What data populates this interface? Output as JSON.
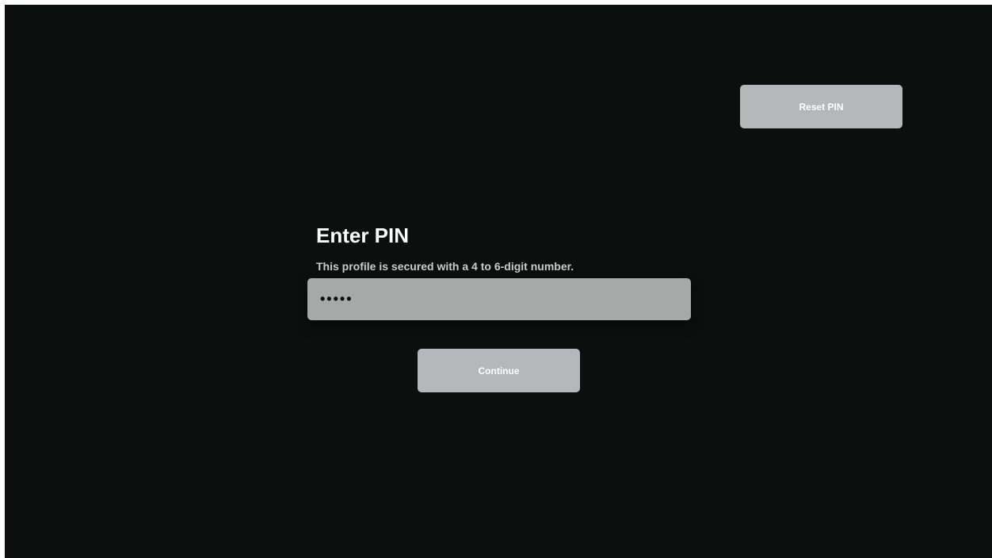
{
  "header": {
    "reset_pin_label": "Reset PIN"
  },
  "pin_entry": {
    "title": "Enter PIN",
    "subtitle": "This profile is secured with a 4 to 6-digit number.",
    "masked_value": "•••••",
    "entered_digit_count": 5
  },
  "actions": {
    "continue_label": "Continue"
  },
  "colors": {
    "background": "#0d0f0f",
    "button_fill": "#b4b8b8",
    "field_fill": "#a7a9a9",
    "text_primary": "#ffffff",
    "text_secondary": "#c9cccc"
  }
}
